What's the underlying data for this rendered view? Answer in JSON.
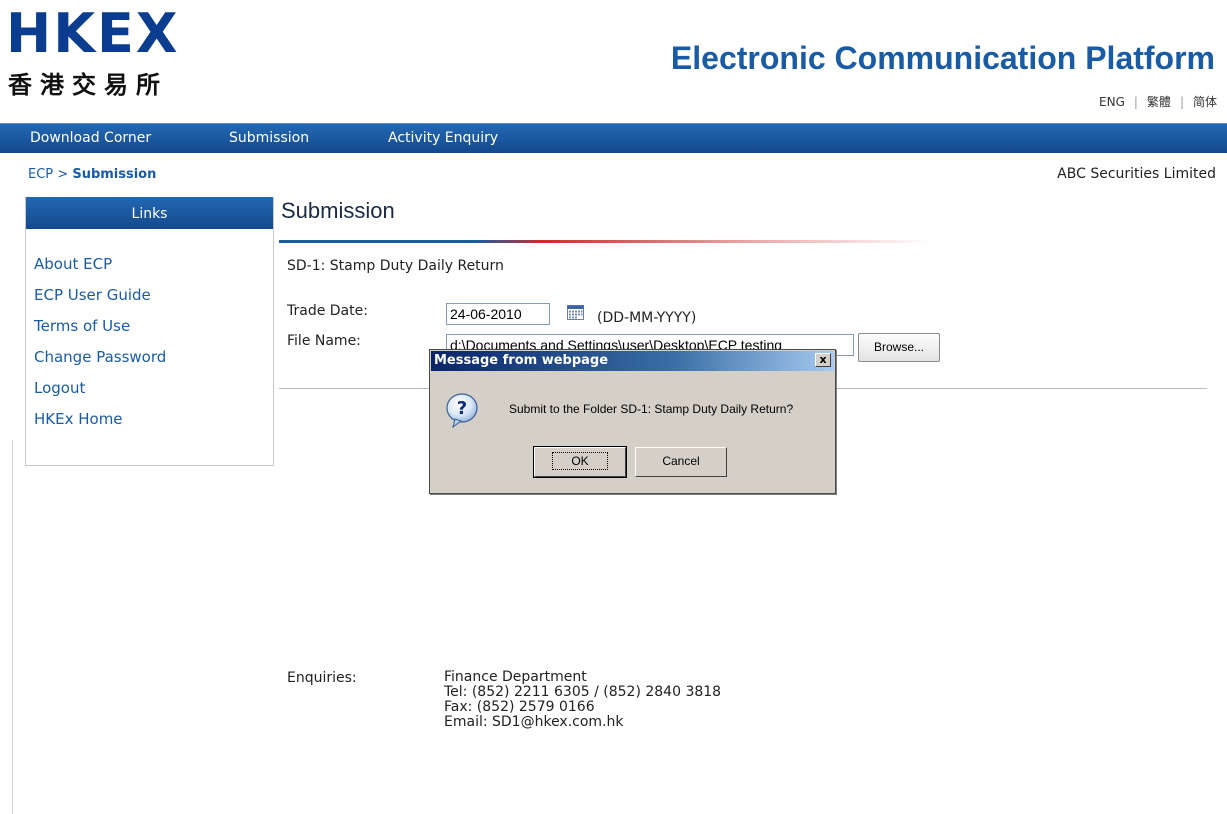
{
  "header": {
    "logo_latin": "HKEX",
    "logo_chinese": "香港交易所",
    "app_title": "Electronic Communication Platform",
    "languages": [
      "ENG",
      "繁體",
      "简体"
    ]
  },
  "nav": {
    "items": [
      "Download Corner",
      "Submission",
      "Activity Enquiry"
    ]
  },
  "breadcrumb": {
    "root": "ECP",
    "separator": ">",
    "current": "Submission"
  },
  "company": "ABC Securities Limited",
  "sidebar": {
    "title": "Links",
    "links": [
      "About ECP",
      "ECP User Guide",
      "Terms of Use",
      "Change Password",
      "Logout",
      "HKEx Home"
    ]
  },
  "main": {
    "page_title": "Submission",
    "form_title": "SD-1: Stamp Duty Daily Return",
    "trade_date_label": "Trade Date:",
    "trade_date_value": "24-06-2010",
    "date_format_hint": "(DD-MM-YYYY)",
    "file_name_label": "File Name:",
    "file_name_value": "d:\\Documents and Settings\\user\\Desktop\\ECP testing",
    "browse_label": "Browse..."
  },
  "dialog": {
    "title": "Message from webpage",
    "close_glyph": "x",
    "message": "Submit to the Folder SD-1: Stamp Duty Daily Return?",
    "ok_label": "OK",
    "cancel_label": "Cancel"
  },
  "enquiries": {
    "label": "Enquiries:",
    "department": "Finance Department",
    "tel": "Tel: (852) 2211 6305 / (852) 2840 3818",
    "fax": "Fax: (852) 2579 0166",
    "email": "Email: SD1@hkex.com.hk"
  },
  "colors": {
    "brand_blue": "#1a5ba6",
    "nav_bar": "#13498c",
    "dialog_title": "#0a246a"
  }
}
